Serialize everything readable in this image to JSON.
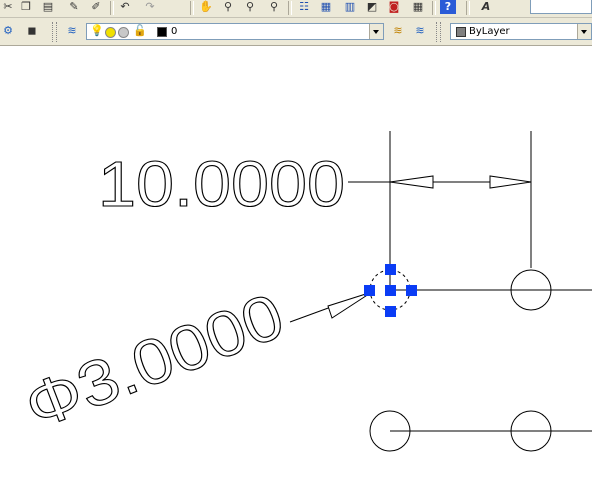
{
  "toolbar_top": {
    "icons": [
      "cut-icon",
      "copy-icon",
      "paste-icon",
      "match-properties-icon",
      "paint-icon",
      "undo-icon",
      "redo-icon",
      "pan-icon",
      "zoom-realtime-icon",
      "zoom-window-icon",
      "zoom-previous-icon",
      "properties-icon",
      "design-center-icon",
      "tool-palettes-icon",
      "sheet-set-icon",
      "markup-icon",
      "calculator-icon",
      "help-icon",
      "text-style-icon"
    ]
  },
  "layers_toolbar": {
    "layer_name": "0",
    "color_value": "ByLayer"
  },
  "drawing": {
    "linear_dimension": "10.0000",
    "diameter_dimension": "Φ3.0000"
  },
  "colors": {
    "toolbar_bg": "#ece9d8",
    "canvas_bg": "#ffffff",
    "grip_blue": "#0a3cf5",
    "geometry": "#000000"
  }
}
